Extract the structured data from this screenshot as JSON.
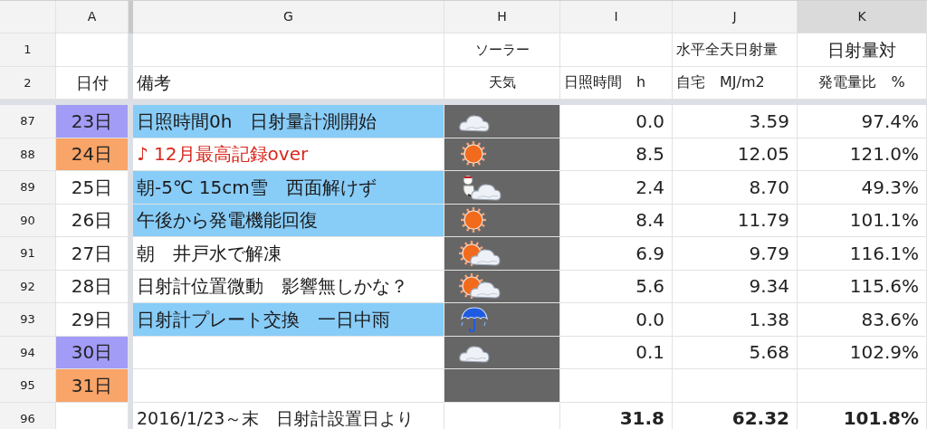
{
  "columns": [
    {
      "label": "A",
      "selected": false
    },
    {
      "label": "G",
      "selected": false
    },
    {
      "label": "H",
      "selected": false
    },
    {
      "label": "I",
      "selected": false
    },
    {
      "label": "J",
      "selected": false
    },
    {
      "label": "K",
      "selected": true
    }
  ],
  "header_rows": [
    {
      "number": "1",
      "h": "ソーラー",
      "j": "水平全天日射量",
      "k": "日射量対"
    },
    {
      "number": "2",
      "a": "日付",
      "g": "備考",
      "h": "天気",
      "i": "日照時間　h",
      "j": "自宅　MJ/m2",
      "k": "発電量比　%"
    }
  ],
  "rows": [
    {
      "number": "87",
      "date": "23日",
      "color": "#a39cf6",
      "note": "日照時間0h　日射量計測開始",
      "note_highlighted": true,
      "note_alert": false,
      "kind": "cloudy",
      "sunshine": "0.0",
      "radiation": "3.59",
      "ratio": "97.4%"
    },
    {
      "number": "88",
      "date": "24日",
      "color": "#f9a468",
      "note": "♪ 12月最高記録over",
      "note_highlighted": false,
      "note_alert": true,
      "kind": "sunny",
      "sunshine": "8.5",
      "radiation": "12.05",
      "ratio": "121.0%"
    },
    {
      "number": "89",
      "date": "25日",
      "color": "#ffffff",
      "note": "朝-5℃ 15cm雪　西面解けず",
      "note_highlighted": true,
      "note_alert": false,
      "kind": "snow",
      "sunshine": "2.4",
      "radiation": "8.70",
      "ratio": "49.3%"
    },
    {
      "number": "90",
      "date": "26日",
      "color": "#ffffff",
      "note": "午後から発電機能回復",
      "note_highlighted": true,
      "note_alert": false,
      "kind": "sunny",
      "sunshine": "8.4",
      "radiation": "11.79",
      "ratio": "101.1%"
    },
    {
      "number": "91",
      "date": "27日",
      "color": "#ffffff",
      "note": "朝　井戸水で解凍",
      "note_highlighted": false,
      "note_alert": false,
      "kind": "sun-cloud",
      "sunshine": "6.9",
      "radiation": "9.79",
      "ratio": "116.1%"
    },
    {
      "number": "92",
      "date": "28日",
      "color": "#ffffff",
      "note": "日射計位置微動　影響無しかな？",
      "note_highlighted": false,
      "note_alert": false,
      "kind": "sun-cloud",
      "sunshine": "5.6",
      "radiation": "9.34",
      "ratio": "115.6%"
    },
    {
      "number": "93",
      "date": "29日",
      "color": "#ffffff",
      "note": "日射計プレート交換　一日中雨",
      "note_highlighted": true,
      "note_alert": false,
      "kind": "rain",
      "sunshine": "0.0",
      "radiation": "1.38",
      "ratio": "83.6%"
    },
    {
      "number": "94",
      "date": "30日",
      "color": "#a39cf6",
      "note_highlighted": false,
      "kind": "cloudy",
      "sunshine": "0.1",
      "radiation": "5.68",
      "ratio": "102.9%"
    },
    {
      "number": "95",
      "date": "31日",
      "color": "#f9a468",
      "note_highlighted": false
    }
  ],
  "total_row": {
    "number": "96",
    "note": "2016/1/23～末　日射計設置日より",
    "sunshine": "31.8",
    "radiation": "62.32",
    "ratio": "101.8%"
  }
}
